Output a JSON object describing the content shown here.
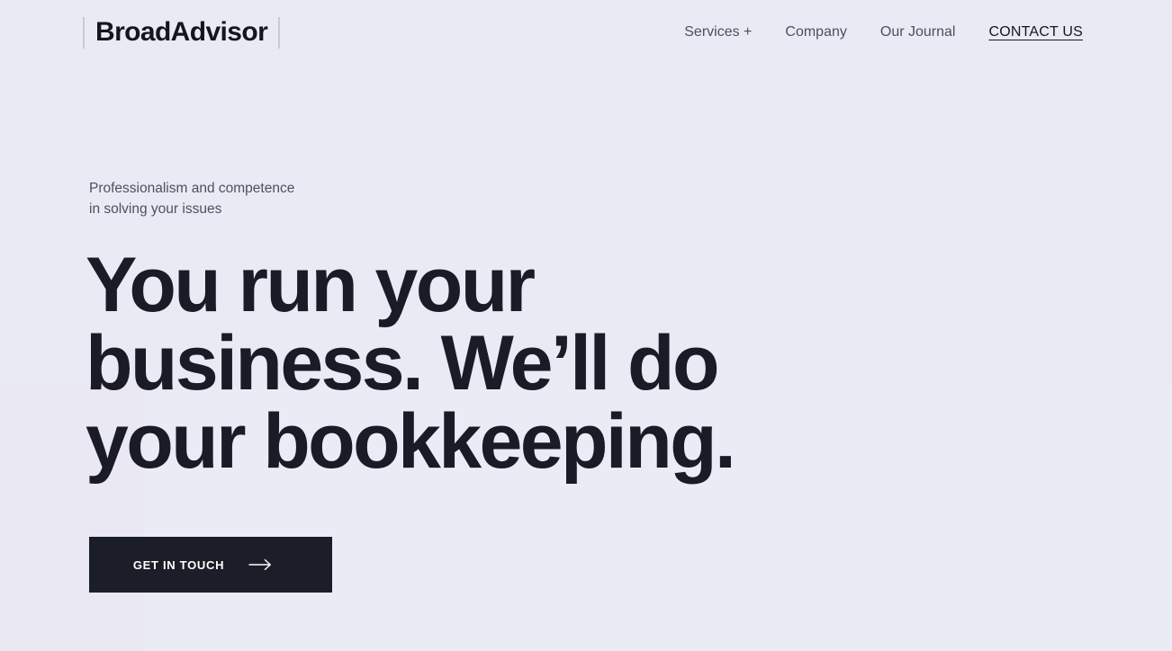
{
  "site": {
    "background_color": "#eaeaf4",
    "accent_dark": "#1b1e28"
  },
  "header": {
    "brand": {
      "name": "BroadAdvisor",
      "left_rule_icon": "vertical-rule-icon",
      "right_rule_icon": "vertical-rule-icon"
    },
    "nav": [
      {
        "label": "Services +",
        "name": "nav-link-services",
        "active": false
      },
      {
        "label": "Company",
        "name": "nav-link-company",
        "active": false
      },
      {
        "label": "Our Journal",
        "name": "nav-link-our-journal",
        "active": false
      },
      {
        "label": "CONTACT US",
        "name": "nav-link-contact-us",
        "active": true
      }
    ]
  },
  "hero": {
    "eyebrow_line1": "Professionalism and competence",
    "eyebrow_line2": "in solving your issues",
    "headline_line1": "You run your",
    "headline_line2": "business. We’ll do",
    "headline_line3": "your bookkeeping.",
    "cta": {
      "label": "GET IN TOUCH",
      "icon": "arrow-right-icon"
    }
  }
}
